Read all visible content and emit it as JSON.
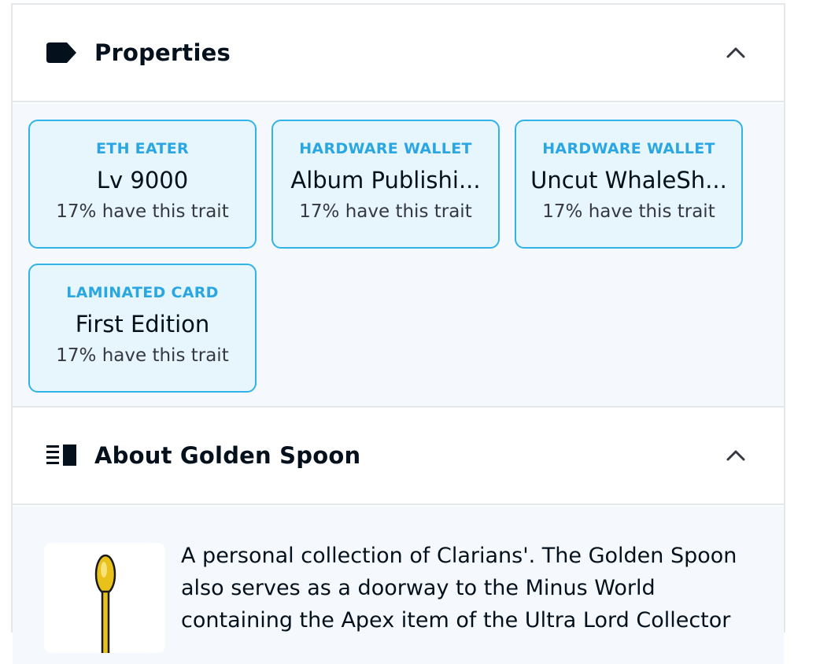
{
  "properties": {
    "title": "Properties",
    "traits": [
      {
        "type": "ETH EATER",
        "value": "Lv 9000",
        "rarity": "17% have this trait"
      },
      {
        "type": "HARDWARE WALLET",
        "value": "Album Publishi...",
        "rarity": "17% have this trait"
      },
      {
        "type": "HARDWARE WALLET",
        "value": "Uncut WhaleSh...",
        "rarity": "17% have this trait"
      },
      {
        "type": "LAMINATED CARD",
        "value": "First Edition",
        "rarity": "17% have this trait"
      }
    ]
  },
  "about": {
    "title": "About Golden Spoon",
    "description": "A personal collection of Clarians'. The Golden Spoon also serves as a doorway to the Minus World containing the Apex item of the Ultra Lord Collector"
  },
  "colors": {
    "accent": "#2aa7e3",
    "trait_bg": "#e7f6fd",
    "body_bg": "#f5f9fd",
    "border": "#e5e8eb"
  }
}
